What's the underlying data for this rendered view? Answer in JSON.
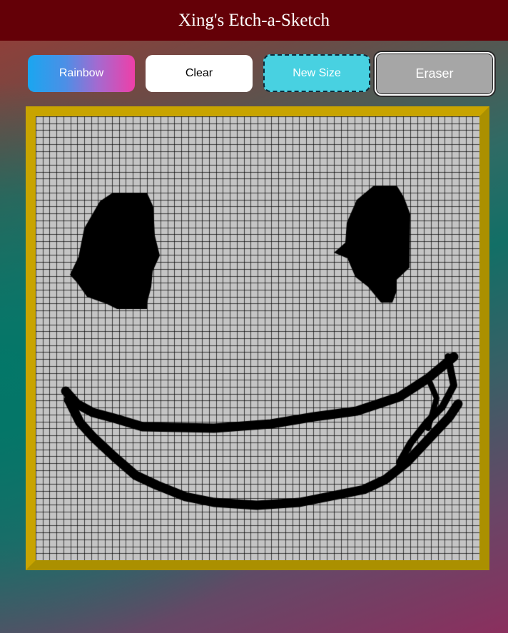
{
  "app": {
    "title": "Xing's Etch-a-Sketch"
  },
  "toolbar": {
    "rainbow_label": "Rainbow",
    "clear_label": "Clear",
    "new_size_label": "New Size",
    "eraser_label": "Eraser"
  },
  "grid": {
    "columns": 64,
    "rows": 64,
    "cell_color": "#c4c4c4",
    "ink_color": "#000000",
    "grid_line_color": "#000000"
  },
  "colors": {
    "header_bg": "#640007",
    "frame_gold": "#ffd700",
    "newsize_bg": "#48d1e1",
    "eraser_bg": "#a6a6a6"
  }
}
